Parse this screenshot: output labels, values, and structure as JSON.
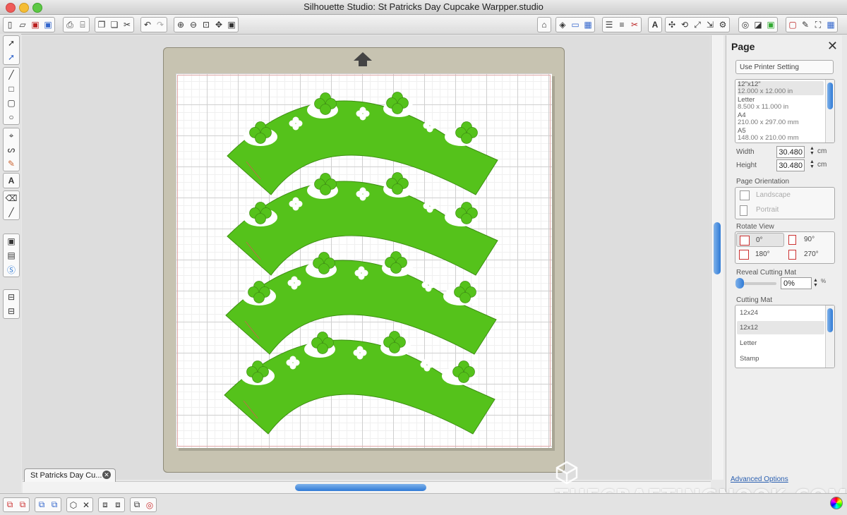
{
  "window": {
    "title": "Silhouette Studio: St Patricks Day Cupcake Warpper.studio"
  },
  "colors": {
    "design_green": "#55c21b",
    "mat_color": "#c7c3b1",
    "accent_blue": "#2f7ad6"
  },
  "toolbar": {
    "left_icons": [
      "new-icon",
      "open-icon",
      "save-icon",
      "save-library-icon",
      "print-icon",
      "send-to-cutter-icon",
      "copy-icon",
      "paste-icon",
      "cut-icon",
      "undo-icon",
      "redo-icon",
      "zoom-in-icon",
      "zoom-out-icon",
      "zoom-box-icon",
      "pan-icon",
      "fit-page-icon"
    ],
    "right_icons": [
      "store-icon",
      "fill-color-icon",
      "line-color-icon",
      "fill-pattern-icon",
      "line-style-icon",
      "line-type-icon",
      "cut-style-icon",
      "text-style-icon",
      "transform-icon",
      "rotate-icon",
      "scale-icon",
      "move-icon",
      "replicate-icon",
      "offset-icon",
      "trace-icon",
      "page-settings-icon",
      "cut-settings-icon",
      "draw-icon",
      "grid-icon"
    ]
  },
  "left_tools": [
    "select-icon",
    "point-edit-icon",
    "line-tool-icon",
    "rectangle-tool-icon",
    "rounded-rectangle-tool-icon",
    "ellipse-tool-icon",
    "polygon-tool-icon",
    "curve-tool-icon",
    "freehand-tool-icon",
    "text-tool-icon",
    "eraser-icon",
    "knife-icon",
    "library-icon",
    "online-store-icon",
    "silhouette-icon",
    "panel-toggle-icon"
  ],
  "document_tab": {
    "label": "St Patricks Day Cu...",
    "close": "✕"
  },
  "panel": {
    "title": "Page",
    "printer_button": "Use Printer Setting",
    "page_sizes": [
      {
        "name": "12\"x12\"",
        "size": "12.000 x 12.000 in"
      },
      {
        "name": "Letter",
        "size": "8.500 x 11.000 in"
      },
      {
        "name": "A4",
        "size": "210.00 x 297.00 mm"
      },
      {
        "name": "A5",
        "size": "148.00 x 210.00 mm"
      }
    ],
    "width_label": "Width",
    "width_value": "30.480",
    "width_unit": "cm",
    "height_label": "Height",
    "height_value": "30.480",
    "height_unit": "cm",
    "orientation_label": "Page Orientation",
    "landscape": "Landscape",
    "portrait": "Portrait",
    "rotate_label": "Rotate View",
    "rotate_0": "0°",
    "rotate_90": "90°",
    "rotate_180": "180°",
    "rotate_270": "270°",
    "reveal_label": "Reveal Cutting Mat",
    "reveal_value": "0%",
    "reveal_unit": "%",
    "reveal_fraction": 0,
    "mat_label": "Cutting Mat",
    "mats": [
      "12x24",
      "12x12",
      "Letter",
      "Stamp"
    ],
    "advanced": "Advanced Options"
  },
  "watermark": "THECRAFTINGNOOK.COM",
  "status_icons": [
    "group-icon",
    "ungroup-icon",
    "compound-path-icon",
    "release-compound-icon",
    "weld-icon",
    "delete-icon",
    "bring-forward-icon",
    "send-backward-icon",
    "send-to-back-icon",
    "registration-marks-icon"
  ]
}
